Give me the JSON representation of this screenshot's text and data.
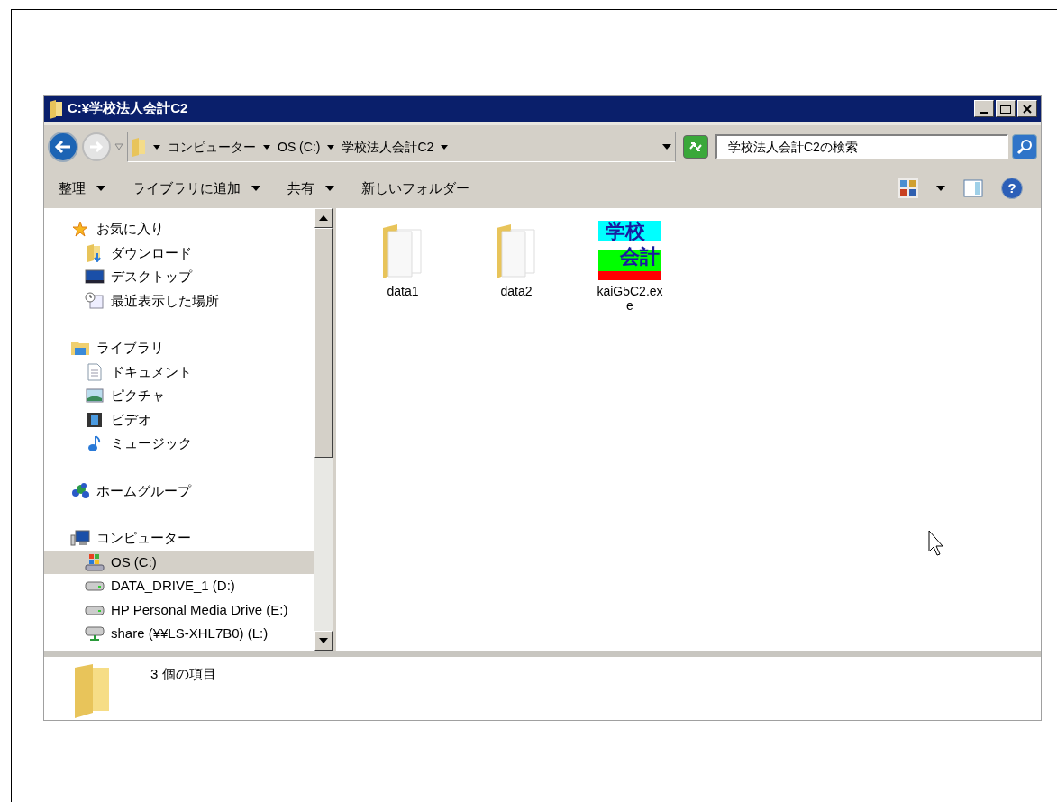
{
  "window": {
    "title": "C:¥学校法人会計C2"
  },
  "address": {
    "crumbs": [
      "コンピューター",
      "OS (C:)",
      "学校法人会計C2"
    ]
  },
  "search": {
    "placeholder": "学校法人会計C2の検索"
  },
  "toolbar": {
    "commands": [
      {
        "label": "整理",
        "dropdown": true
      },
      {
        "label": "ライブラリに追加",
        "dropdown": true
      },
      {
        "label": "共有",
        "dropdown": true
      },
      {
        "label": "新しいフォルダー",
        "dropdown": false
      }
    ]
  },
  "sidebar": {
    "groups": [
      {
        "label": "お気に入り",
        "kind": "star",
        "selected": false,
        "children": [
          {
            "label": "ダウンロード",
            "kind": "download",
            "selected": false
          },
          {
            "label": "デスクトップ",
            "kind": "desktop",
            "selected": false
          },
          {
            "label": "最近表示した場所",
            "kind": "recent",
            "selected": false
          }
        ]
      },
      {
        "label": "ライブラリ",
        "kind": "library",
        "selected": false,
        "children": [
          {
            "label": "ドキュメント",
            "kind": "document",
            "selected": false
          },
          {
            "label": "ピクチャ",
            "kind": "picture",
            "selected": false
          },
          {
            "label": "ビデオ",
            "kind": "video",
            "selected": false
          },
          {
            "label": "ミュージック",
            "kind": "music",
            "selected": false
          }
        ]
      },
      {
        "label": "ホームグループ",
        "kind": "homegroup",
        "selected": false
      },
      {
        "label": "コンピューター",
        "kind": "computer",
        "selected": false,
        "children": [
          {
            "label": "OS (C:)",
            "kind": "osdrive",
            "selected": true
          },
          {
            "label": "DATA_DRIVE_1 (D:)",
            "kind": "drive",
            "selected": false
          },
          {
            "label": "HP Personal Media Drive (E:)",
            "kind": "drive",
            "selected": false
          },
          {
            "label": "share (¥¥LS-XHL7B0) (L:)",
            "kind": "netdrive",
            "selected": false
          }
        ]
      }
    ]
  },
  "files": [
    {
      "name": "data1",
      "kind": "folder"
    },
    {
      "name": "data2",
      "kind": "folder"
    },
    {
      "name": "kaiG5C2.exe",
      "kind": "app",
      "icon_lines": [
        "学校",
        "会計"
      ]
    }
  ],
  "details": {
    "summary": "3 個の項目"
  },
  "help": {
    "glyph": "?"
  }
}
